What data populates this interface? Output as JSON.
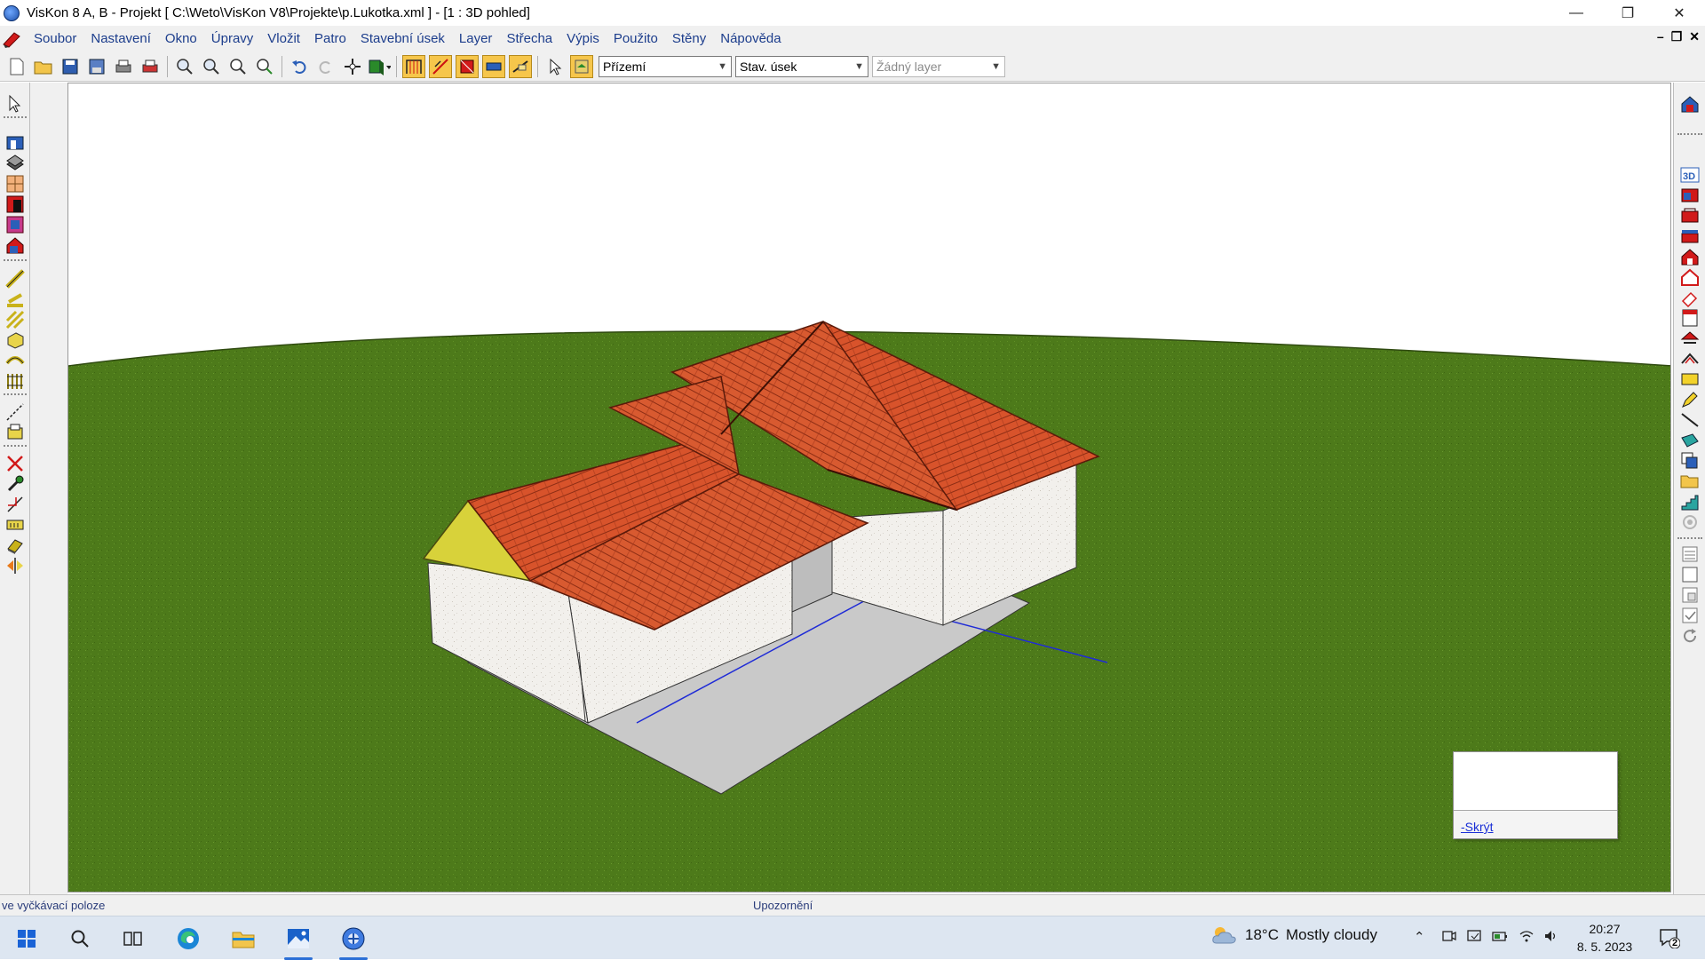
{
  "window": {
    "title": "VisKon 8 A, B - Projekt [ C:\\Weto\\VisKon V8\\Projekte\\p.Lukotka.xml ]  - [1 : 3D pohled]",
    "controls": {
      "minimize": "—",
      "restore": "❐",
      "close": "✕"
    }
  },
  "menubar": {
    "items": [
      "Soubor",
      "Nastavení",
      "Okno",
      "Úpravy",
      "Vložit",
      "Patro",
      "Stavební úsek",
      "Layer",
      "Střecha",
      "Výpis",
      "Použito",
      "Stěny",
      "Nápověda"
    ],
    "mdi_controls": {
      "minimize": "–",
      "restore": "❐",
      "close": "✕"
    }
  },
  "toolbar": {
    "floor_select": "Přízemí",
    "section_select": "Stav. úsek",
    "layer_select": "Žádný layer"
  },
  "viewport": {
    "view_name": "3D pohled",
    "colors": {
      "sky": "#ffffff",
      "ground": "#4d7a1a",
      "roof": "#d8532b",
      "wall": "#f2f0ec",
      "gable": "#d8d23a",
      "floor": "#c9c9c9"
    }
  },
  "notice": {
    "link": "-Skrýt"
  },
  "statusbar": {
    "left": "ve vyčkávací poloze",
    "center": "Upozornění"
  },
  "taskbar": {
    "weather": {
      "temp": "18°C",
      "condition": "Mostly cloudy"
    },
    "clock": {
      "time": "20:27",
      "date": "8. 5. 2023"
    },
    "notifications_count": "2"
  }
}
